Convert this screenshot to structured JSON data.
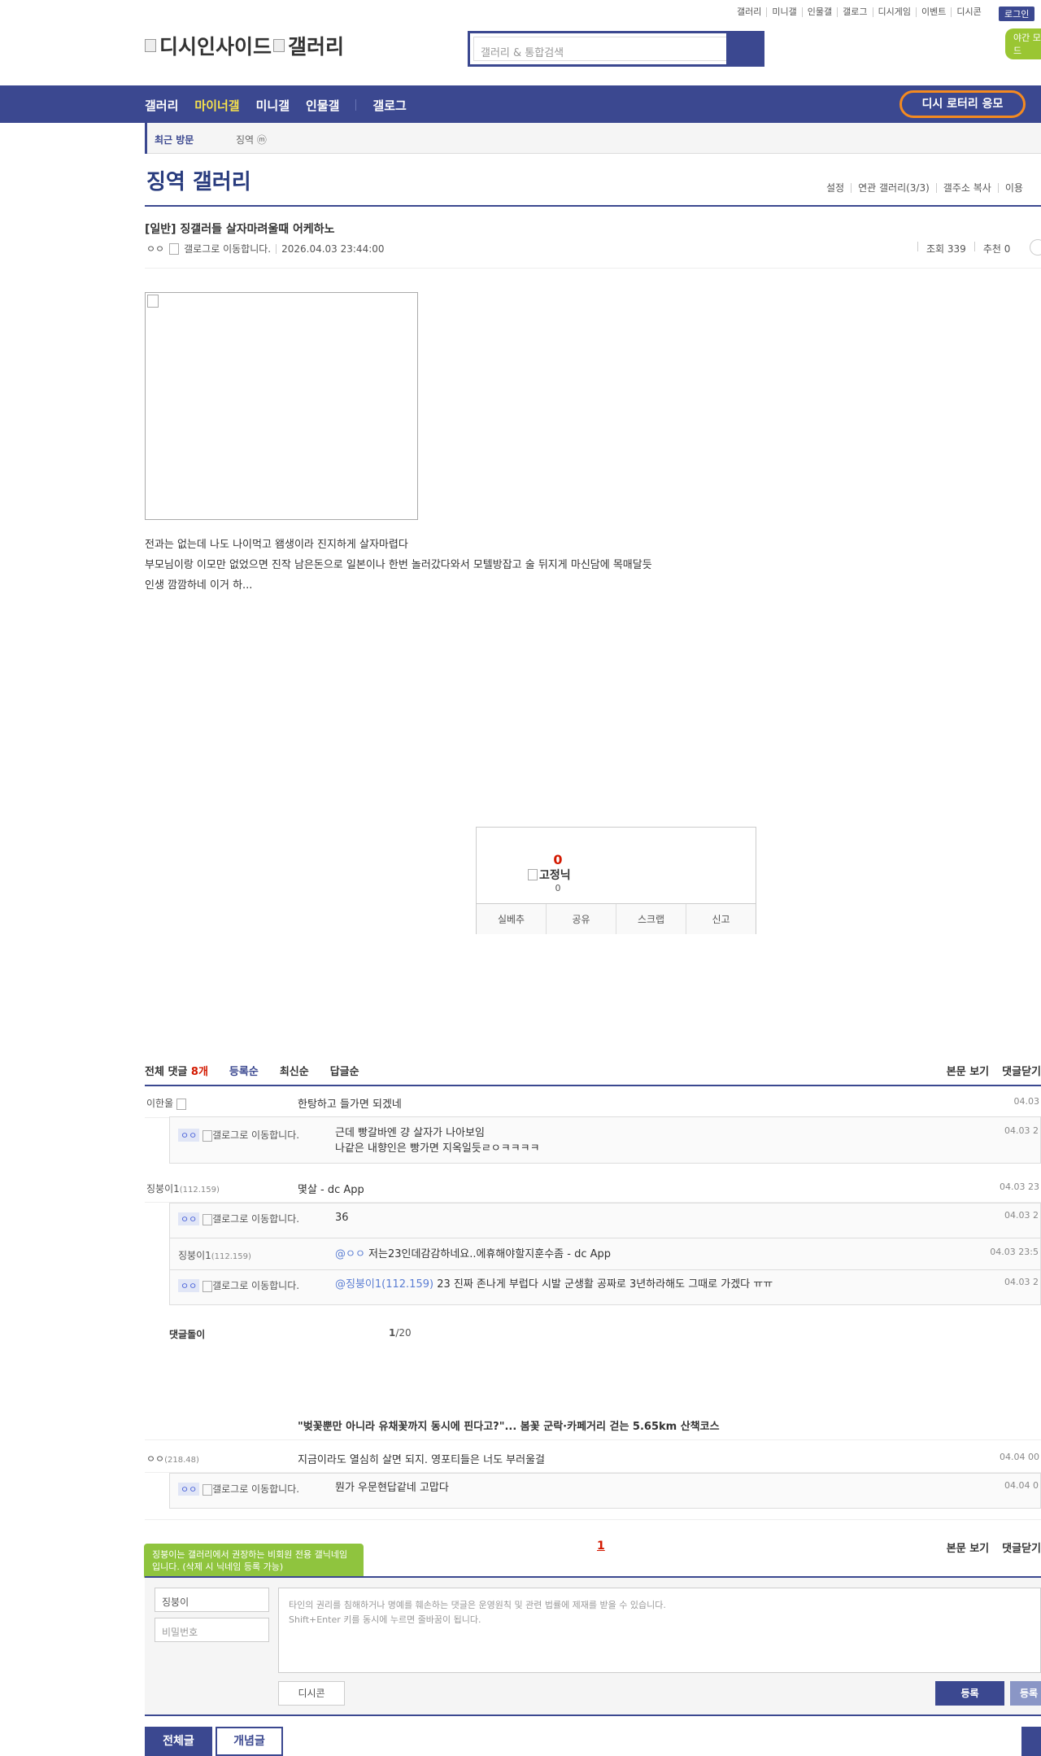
{
  "topbar": {
    "links": [
      "갤러리",
      "미니갤",
      "인물갤",
      "갤로그",
      "디시게임",
      "이벤트",
      "디시콘"
    ],
    "login": "로그인",
    "night_mode": "야간 모드"
  },
  "logo": {
    "main": "디시인사이드",
    "sub": "갤러리"
  },
  "search": {
    "placeholder": "갤러리 & 통합검색"
  },
  "nav": {
    "items": [
      "갤러리",
      "마이너갤",
      "미니갤",
      "인물갤",
      "갤로그"
    ],
    "active": "마이너갤",
    "lottery": "디시 로터리 응모"
  },
  "recent": {
    "label": "최근 방문",
    "item": "징역 ⓜ"
  },
  "gallery": {
    "title": "징역 갤러리",
    "links": [
      "설정",
      "연관 갤러리(3/3)",
      "갤주소 복사",
      "이용"
    ]
  },
  "post": {
    "title": "[일반] 징갤러들 살자마려울때 어케하노",
    "author": "ㅇㅇ",
    "gallog_alt": "갤로그로 이동합니다.",
    "date": "2026.04.03 23:44:00",
    "views": "조회 339",
    "recommend": "추천 0",
    "body": [
      "전과는 없는데 나도 나이먹고 왬생이라 진지하게 살자마렵다",
      "부모님이랑 이모만 없었으면 진작 남은돈으로 일본이나 한번 놀러갔다와서 모텔방잡고 술 뒤지게 마신담에 목매달듯",
      "인생 깜깜하네 이거 하..."
    ]
  },
  "recommend_box": {
    "count": "0",
    "fixed_nick": "고정닉",
    "fixed_count": "0",
    "buttons": [
      "실베추",
      "공유",
      "스크랩",
      "신고"
    ]
  },
  "comments": {
    "total_label": "전체 댓글",
    "total_count": "8개",
    "sort": [
      "등록순",
      "최신순",
      "답글순"
    ],
    "right": [
      "본문 보기",
      "댓글닫기"
    ],
    "c1": {
      "nick": "이한울",
      "text": "한탕하고 들가면 되겠네",
      "date": "04.03"
    },
    "r1": {
      "nick": "ㅇㅇ",
      "alt": "갤로그로 이동합니다.",
      "line1": "근데 빵갈바엔 걍 살자가 나아보임",
      "line2": "나같은 내향인은 빵가면 지옥일듯ㄹㅇㅋㅋㅋㅋ",
      "date": "04.03 2"
    },
    "c2": {
      "nick": "징붕이1",
      "ip": "(112.159)",
      "text": "몇살 - dc App",
      "date": "04.03 23"
    },
    "r2": {
      "nick": "ㅇㅇ",
      "alt": "갤로그로 이동합니다.",
      "text": "36",
      "date": "04.03 2"
    },
    "r3": {
      "nick": "징붕이1",
      "ip": "(112.159)",
      "mention": "@ㅇㅇ",
      "text": " 저는23인데감감하네요..에휴해야할지훈수좀 - dc App",
      "date": "04.03 23:5"
    },
    "r4": {
      "nick": "ㅇㅇ",
      "alt": "갤로그로 이동합니다.",
      "mention": "@징붕이1(112.159)",
      "text": " 23 진짜 존나게 부럽다 시발 군생활 공짜로 3년하라해도 그때로 가겠다 ㅠㅠ",
      "date": "04.03 2"
    },
    "reply_page_label": "댓글돌이",
    "reply_page_cur": "1",
    "reply_page_total": "/20",
    "news": "\"벚꽃뿐만 아니라 유채꽃까지 동시에 핀다고?\"... 봄꽃 군락·카페거리 걷는 5.65km 산책코스",
    "c3": {
      "nick": "ㅇㅇ",
      "ip": "(218.48)",
      "text": "지금이라도 열심히 살면 되지. 영포티들은 너도 부러울걸",
      "date": "04.04 00"
    },
    "r5": {
      "nick": "ㅇㅇ",
      "alt": "갤로그로 이동합니다.",
      "text": "뭔가 우문현답같네 고맙다",
      "date": "04.04 0"
    },
    "page": "1"
  },
  "write": {
    "tip": "징붕이는 갤러리에서 권장하는 비회원 전용 갤닉네임입니다. (삭제 시 닉네임 등록 가능)",
    "nick": "징붕이",
    "pw_placeholder": "비밀번호",
    "notice1": "타인의 권리를 침해하거나 명예를 훼손하는 댓글은 운영원칙 및 관련 법률에 제재를 받을 수 있습니다.",
    "notice2": "Shift+Enter 키를 동시에 누르면 줄바꿈이 됩니다.",
    "dccon": "디시콘",
    "submit": "등록",
    "submit2": "등록"
  },
  "bottom": {
    "all": "전체글",
    "concept": "개념글"
  }
}
